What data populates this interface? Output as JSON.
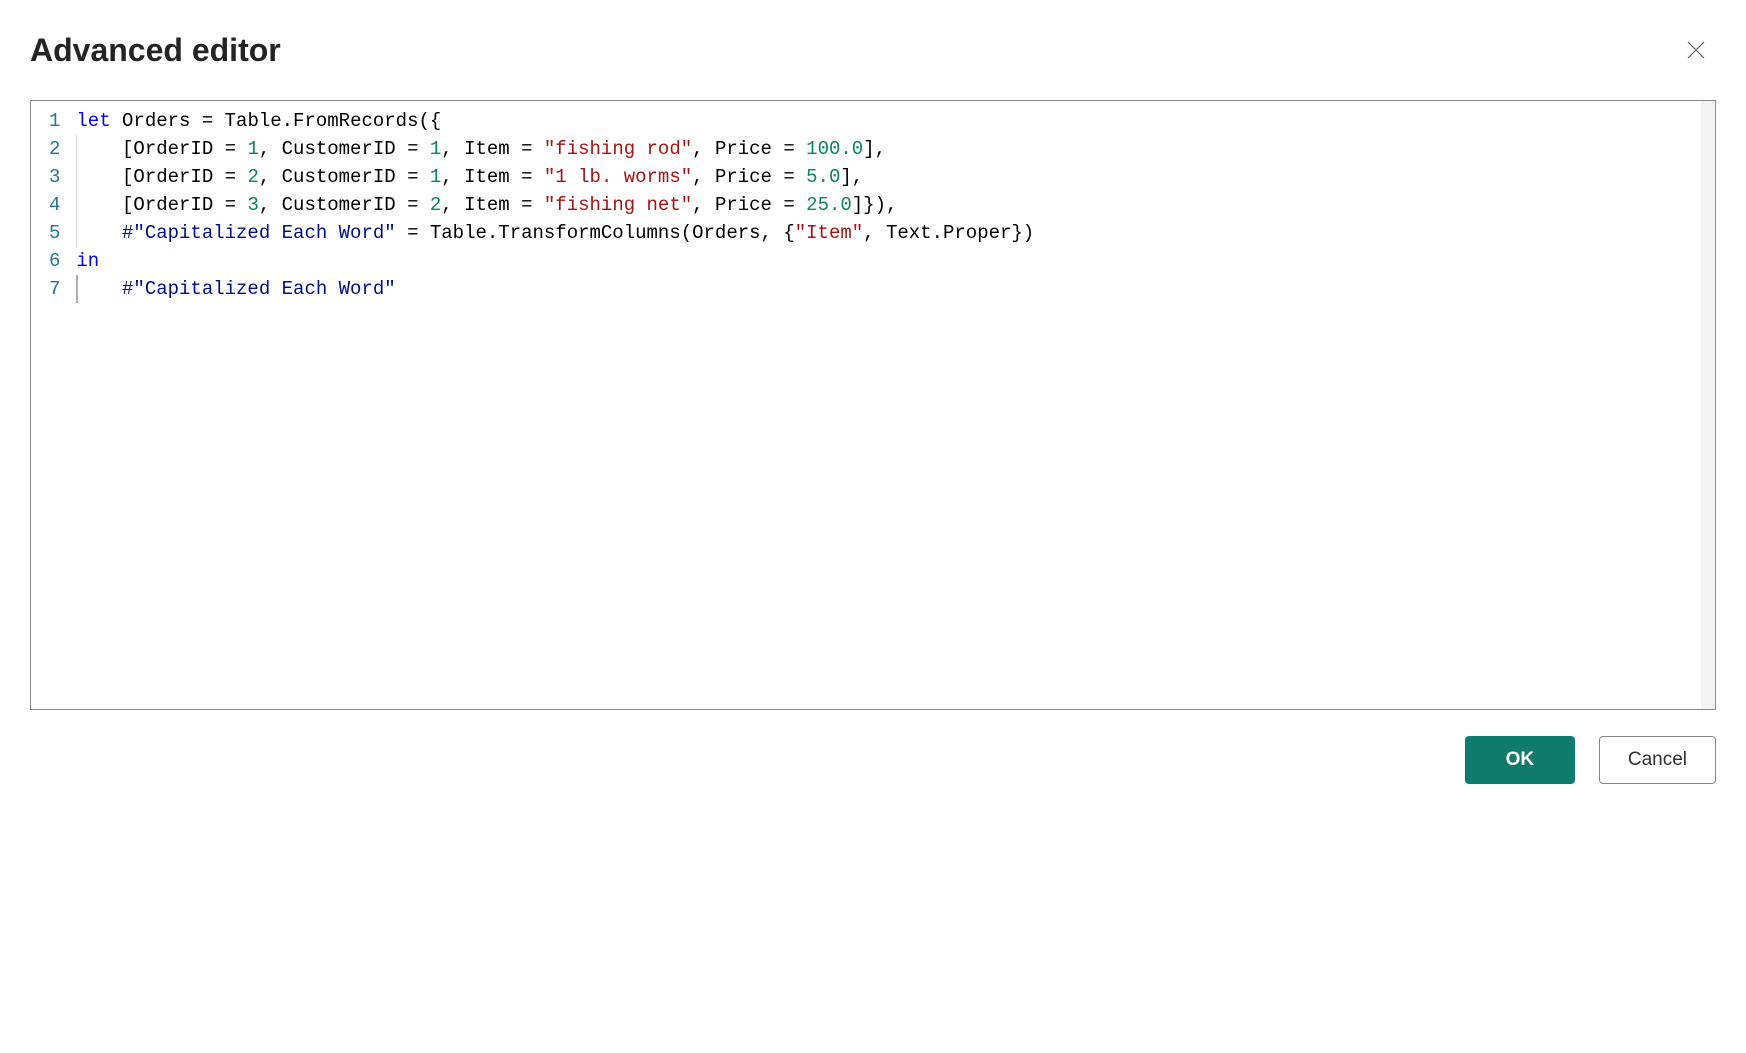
{
  "dialog": {
    "title": "Advanced editor",
    "close_label": "Close"
  },
  "colors": {
    "primary": "#0f7b6c",
    "keyword": "#0000ff",
    "number": "#098658",
    "string": "#a31515"
  },
  "editor": {
    "total_lines": 7,
    "cursor_line": 7,
    "lines": [
      {
        "n": 1,
        "indent_guides": 0,
        "tokens": [
          {
            "t": "let",
            "c": "keyword"
          },
          {
            "t": " Orders = Table.FromRecords({",
            "c": "ident"
          }
        ]
      },
      {
        "n": 2,
        "indent_guides": 1,
        "tokens": [
          {
            "t": "    [OrderID = ",
            "c": "ident"
          },
          {
            "t": "1",
            "c": "number"
          },
          {
            "t": ", CustomerID = ",
            "c": "ident"
          },
          {
            "t": "1",
            "c": "number"
          },
          {
            "t": ", Item = ",
            "c": "ident"
          },
          {
            "t": "\"fishing rod\"",
            "c": "string"
          },
          {
            "t": ", Price = ",
            "c": "ident"
          },
          {
            "t": "100.0",
            "c": "number"
          },
          {
            "t": "],",
            "c": "ident"
          }
        ]
      },
      {
        "n": 3,
        "indent_guides": 1,
        "tokens": [
          {
            "t": "    [OrderID = ",
            "c": "ident"
          },
          {
            "t": "2",
            "c": "number"
          },
          {
            "t": ", CustomerID = ",
            "c": "ident"
          },
          {
            "t": "1",
            "c": "number"
          },
          {
            "t": ", Item = ",
            "c": "ident"
          },
          {
            "t": "\"1 lb. worms\"",
            "c": "string"
          },
          {
            "t": ", Price = ",
            "c": "ident"
          },
          {
            "t": "5.0",
            "c": "number"
          },
          {
            "t": "],",
            "c": "ident"
          }
        ]
      },
      {
        "n": 4,
        "indent_guides": 1,
        "tokens": [
          {
            "t": "    [OrderID = ",
            "c": "ident"
          },
          {
            "t": "3",
            "c": "number"
          },
          {
            "t": ", CustomerID = ",
            "c": "ident"
          },
          {
            "t": "2",
            "c": "number"
          },
          {
            "t": ", Item = ",
            "c": "ident"
          },
          {
            "t": "\"fishing net\"",
            "c": "string"
          },
          {
            "t": ", Price = ",
            "c": "ident"
          },
          {
            "t": "25.0",
            "c": "number"
          },
          {
            "t": "]}),",
            "c": "ident"
          }
        ]
      },
      {
        "n": 5,
        "indent_guides": 1,
        "tokens": [
          {
            "t": "    ",
            "c": "ident"
          },
          {
            "t": "#\"Capitalized Each Word\"",
            "c": "quoted-ident"
          },
          {
            "t": " = Table.TransformColumns(Orders, {",
            "c": "ident"
          },
          {
            "t": "\"Item\"",
            "c": "string"
          },
          {
            "t": ", Text.Proper})",
            "c": "ident"
          }
        ]
      },
      {
        "n": 6,
        "indent_guides": 0,
        "tokens": [
          {
            "t": "in",
            "c": "keyword"
          }
        ]
      },
      {
        "n": 7,
        "indent_guides": 1,
        "tokens": [
          {
            "t": "    ",
            "c": "ident"
          },
          {
            "t": "#\"Capitalized Each Word\"",
            "c": "quoted-ident"
          }
        ]
      }
    ]
  },
  "footer": {
    "ok_label": "OK",
    "cancel_label": "Cancel"
  }
}
